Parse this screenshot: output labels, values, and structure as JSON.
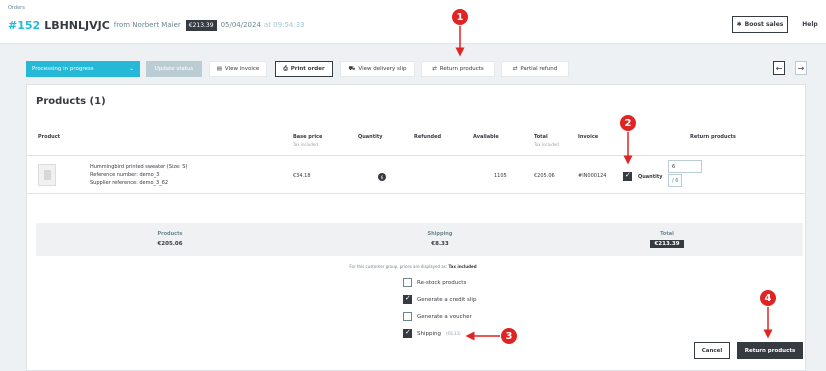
{
  "breadcrumb": "Orders",
  "order": {
    "id": "#152",
    "reference": "LBHNLJVJC",
    "from": "from Norbert Maier",
    "amount": "€213.39",
    "date": "05/04/2024",
    "time": "at 09:54:33"
  },
  "header_actions": {
    "boost_sales": "Boost sales",
    "help": "Help"
  },
  "toolbar": {
    "status": "Processing in progress",
    "update_status": "Update status",
    "view_invoice": "View invoice",
    "print_order": "Print order",
    "view_delivery_slip": "View delivery slip",
    "return_products": "Return products",
    "partial_refund": "Partial refund"
  },
  "products": {
    "title": "Products (1)",
    "columns": {
      "product": "Product",
      "base_price": "Base price",
      "base_price_sub": "Tax included",
      "quantity": "Quantity",
      "refunded": "Refunded",
      "available": "Available",
      "total": "Total",
      "total_sub": "Tax included",
      "invoice": "Invoice",
      "return_products": "Return products"
    },
    "row": {
      "name": "Hummingbird printed sweater (Size: S)",
      "reference": "Reference number: demo_3",
      "supplier_reference": "Supplier reference: demo_3_62",
      "base_price": "€34.18",
      "quantity": "6",
      "available": "1105",
      "total": "€205.06",
      "invoice": "#IN000124",
      "return_quantity_label": "Quantity",
      "return_quantity_value": "6",
      "return_quantity_max": "/ 6"
    }
  },
  "summary": {
    "products_label": "Products",
    "products_value": "€205.06",
    "shipping_label": "Shipping",
    "shipping_value": "€8.33",
    "total_label": "Total",
    "total_value": "€213.39"
  },
  "note": {
    "text": "For this customer group, prices are displayed as:",
    "emphasis": "Tax included"
  },
  "options": {
    "restock": {
      "label": "Re-stock products",
      "checked": false
    },
    "credit_slip": {
      "label": "Generate a credit slip",
      "checked": true
    },
    "voucher": {
      "label": "Generate a voucher",
      "checked": false
    },
    "shipping": {
      "label": "Shipping",
      "amount": "(€8.33)",
      "checked": true
    }
  },
  "footer_actions": {
    "cancel": "Cancel",
    "return_products": "Return products"
  },
  "annotations": [
    "1",
    "2",
    "3",
    "4"
  ],
  "colors": {
    "accent": "#25b9d7",
    "dark": "#363a41",
    "annotation": "#e02424",
    "disabled": "#bbcdd2"
  }
}
